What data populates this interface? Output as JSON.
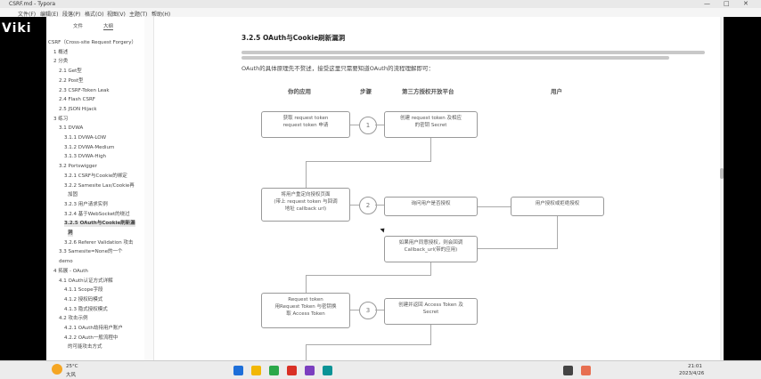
{
  "window": {
    "title": "CSRF.md - Typora",
    "controls": [
      "—",
      "□",
      "✕"
    ]
  },
  "menu": {
    "items": [
      "文件(F)",
      "编辑(E)",
      "段落(P)",
      "格式(O)",
      "视图(V)",
      "主题(T)",
      "帮助(H)"
    ]
  },
  "watermark": "Viki",
  "sidebar": {
    "tabs": [
      "文件",
      "大纲"
    ],
    "outline": [
      "CSRF（Cross-site Request Forgery）",
      "1 概述",
      "2 分类",
      "2.1 Get型",
      "2.2 Post型",
      "2.3 CSRF-Token Leak",
      "2.4 Flash CSRF",
      "2.5 JSON Hijack",
      "3 练习",
      "3.1 DVWA",
      "3.1.1 DVWA-LOW",
      "3.1.2 DVWA-Medium",
      "3.1.3 DVWA-High",
      "3.2 Portswigger",
      "3.2.1 CSRF与Cookie的绑定",
      "3.2.2 Samesite Lax/Cookie再",
      "加固",
      "3.2.3 用户请求实例",
      "3.2.4 基于WebSocket的绕过",
      "3.2.5 OAuth与Cookie刷新漏",
      "洞",
      "3.2.6 Referer Validation 攻击",
      "3.3 Samesite=None的一个",
      "demo",
      "4 拓展 - OAuth",
      "4.1 OAuth认证方式详解",
      "4.1.1 Scope字段",
      "4.1.2 授权码模式",
      "4.1.3 隐式授权模式",
      "4.2 攻击示例",
      "4.2.1 OAuth劫持用户账户",
      "4.2.2 OAuth一般流程中",
      "的可能攻击方式"
    ]
  },
  "content": {
    "heading": "3.2.5 OAuth与Cookie刷新漏洞",
    "paragraph": "OAuth的具体原理先不赘述，接受这里只需要知道OAuth的流程理解即可：",
    "columns": [
      "你的应用",
      "步骤",
      "第三方授权开放平台",
      "用户"
    ],
    "steps": [
      "1",
      "2",
      "3"
    ],
    "boxes": {
      "app1": "获取 request token",
      "app1_sub": "request token 申请",
      "plat1": "创建 request token 及相应",
      "plat1_sub": "的密钥 Secret",
      "app2": "将用户重定向授权页面",
      "app2_sub": "(带上 request token 与回调",
      "app2_sub2": "地址 callback url)",
      "plat2": "询问用户是否授权",
      "user1": "用户授权或拒绝授权",
      "plat3": "如果用户同意授权，则会回调",
      "plat3_sub": "Callback_url(带的应用)",
      "app3": "Request token",
      "app3_sub": "用Request Token 与密钥换",
      "app3_sub2": "取 Access Token",
      "plat4": "创建并返回 Access Token 及",
      "plat4_sub": "Secret"
    }
  },
  "taskbar": {
    "weather_temp": "25°C",
    "weather_desc": "大风",
    "time": "21:01",
    "date": "2023/4/26",
    "icon_colors": [
      "#1e6fd9",
      "#f2b705",
      "#2ba84a",
      "#d93025",
      "#7b3fbf",
      "#0a9396",
      "#444444",
      "#e76f51"
    ]
  }
}
